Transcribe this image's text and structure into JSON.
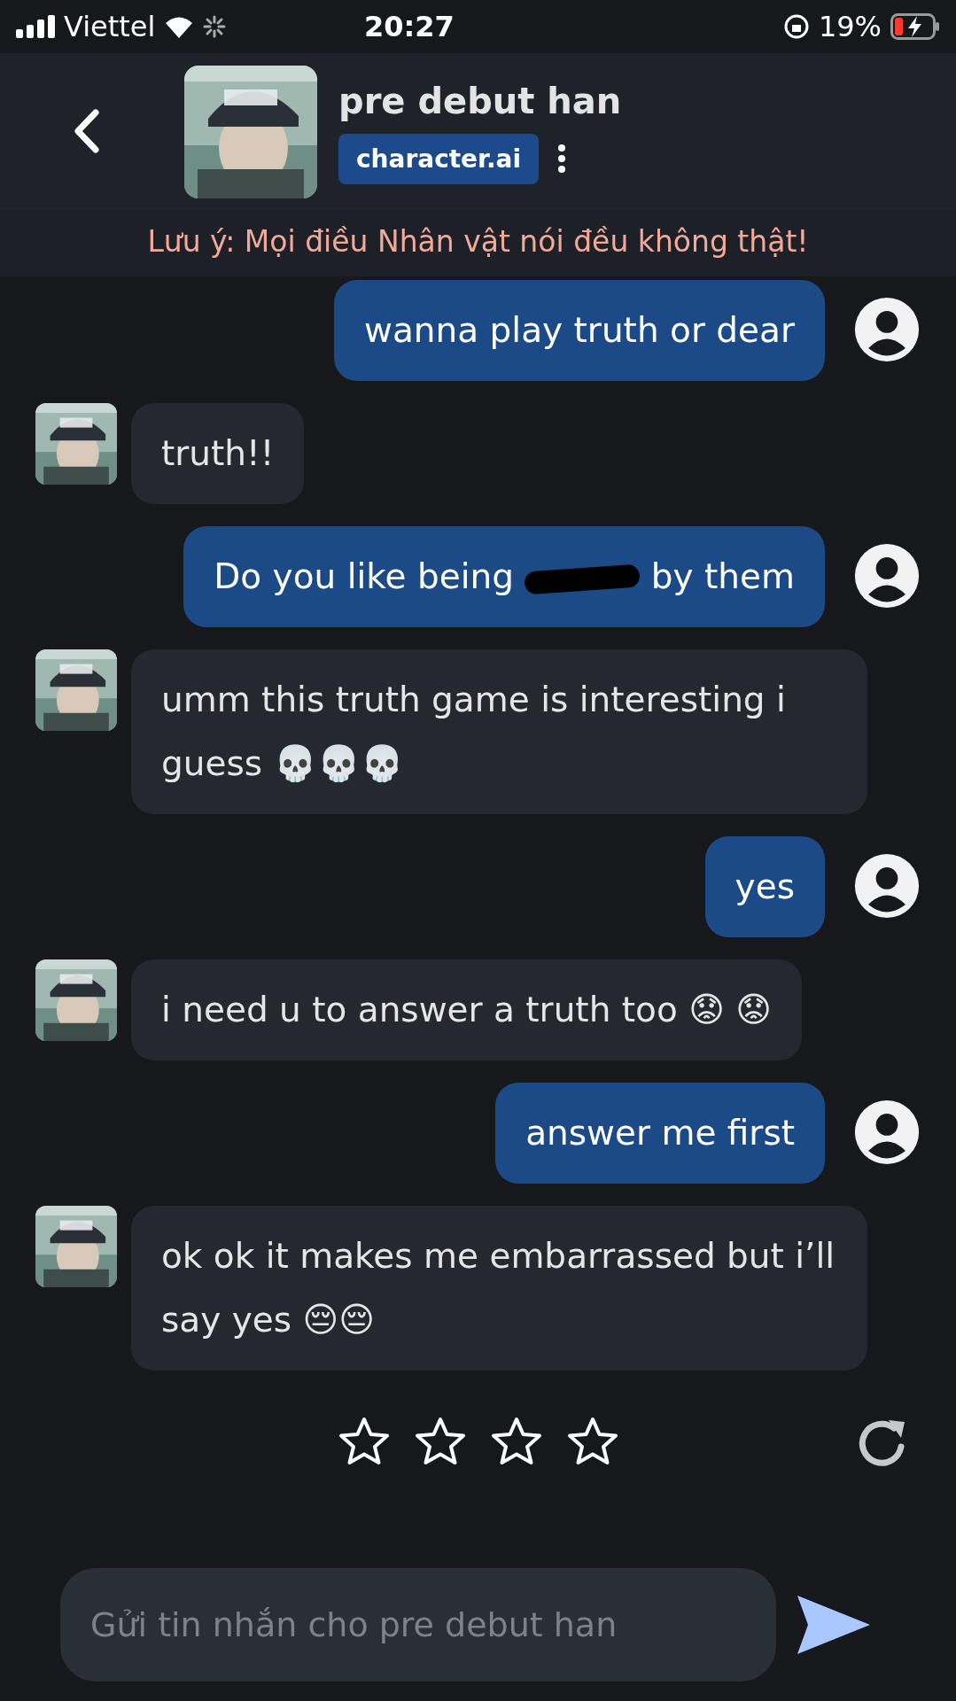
{
  "status_bar": {
    "carrier": "Viettel",
    "time": "20:27",
    "battery": "19%"
  },
  "header": {
    "name": "pre debut han",
    "badge": "character.ai"
  },
  "notice": "Lưu ý: Mọi điều Nhân vật nói đều không thật!",
  "messages": [
    {
      "kind": "user",
      "text": "wanna play truth or dear"
    },
    {
      "kind": "bot",
      "text": "truth!!"
    },
    {
      "kind": "user",
      "text": "Do you like being",
      "redacted": true,
      "text_after": "by them"
    },
    {
      "kind": "bot",
      "text": "umm this truth game is interesting i guess 💀💀💀"
    },
    {
      "kind": "user",
      "text": "yes"
    },
    {
      "kind": "bot",
      "text": "i need u to answer a truth too 😟 😟"
    },
    {
      "kind": "user",
      "text": "answer me first"
    },
    {
      "kind": "bot",
      "text": "ok ok it makes me embarrassed but i’ll say yes 😔😔"
    }
  ],
  "rating": {
    "stars": 0
  },
  "composer": {
    "placeholder": "Gửi tin nhắn cho pre debut han"
  }
}
